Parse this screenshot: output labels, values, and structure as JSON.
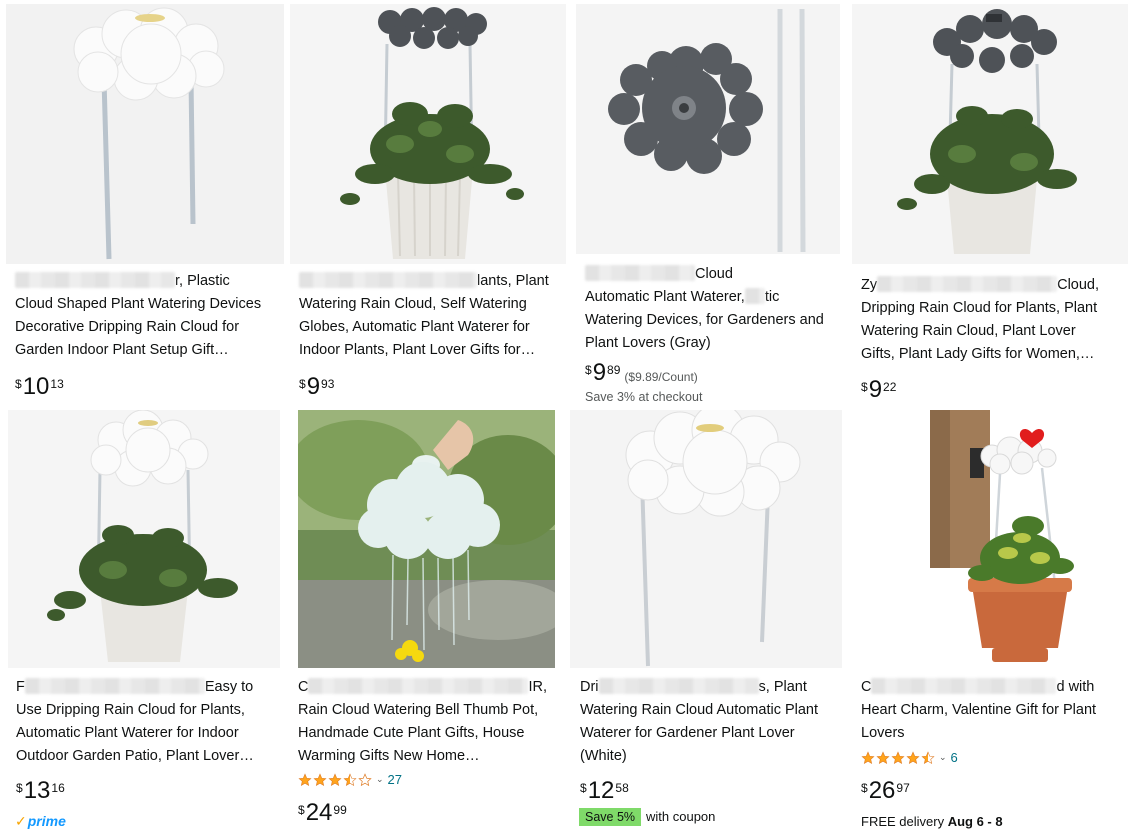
{
  "products": [
    {
      "title_visible": "r, Plastic Cloud Shaped Plant Watering Devices Decorative Dripping Rain Cloud for Garden Indoor Plant Setup Gift…",
      "line1": "r, Plastic",
      "line2": "Cloud Shaped Plant Watering Devices",
      "line3": "Decorative Dripping Rain Cloud for",
      "line4": "Garden Indoor Plant Setup Gift…",
      "price_symbol": "$",
      "price_whole": "10",
      "price_fraction": "13",
      "image_alt": "white-cloud-waterer"
    },
    {
      "line1a": "lants, Plant",
      "line2": "Watering Rain Cloud, Self Watering",
      "line3": "Globes, Automatic Plant Waterer for",
      "line4": "Indoor Plants, Plant Lover Gifts for…",
      "price_symbol": "$",
      "price_whole": "9",
      "price_fraction": "93",
      "image_alt": "gray-cloud-with-plant"
    },
    {
      "line1": "Cloud",
      "line2a": "Automatic Plant Waterer,",
      "line2b": "tic",
      "line3": "Watering Devices, for Gardeners and",
      "line4": "Plant Lovers (Gray)",
      "price_symbol": "$",
      "price_whole": "9",
      "price_fraction": "89",
      "unit_price": "($9.89/Count)",
      "save_text": "Save 3% at checkout",
      "image_alt": "gray-cloud-top-view"
    },
    {
      "line1a": "Zy",
      "line1b": "Cloud,",
      "line2": "Dripping Rain Cloud for Plants, Plant",
      "line3": "Watering Rain Cloud, Plant Lover",
      "line4": "Gifts, Plant Lady Gifts for Women,…",
      "price_symbol": "$",
      "price_whole": "9",
      "price_fraction": "22",
      "image_alt": "gray-cloud-with-plant-2"
    },
    {
      "line1a": "F",
      "line1b": "Easy to",
      "line2": "Use Dripping Rain Cloud for Plants,",
      "line3": "Automatic Plant Waterer for Indoor",
      "line4": "Outdoor Garden Patio, Plant Lover…",
      "price_symbol": "$",
      "price_whole": "13",
      "price_fraction": "16",
      "prime_label": "prime",
      "image_alt": "white-cloud-with-plant"
    },
    {
      "line1a": "C",
      "line1b": "IR,",
      "line2": "Rain Cloud Watering Bell Thumb Pot,",
      "line3": "Handmade Cute Plant Gifts, House",
      "line4": "Warming Gifts New Home…",
      "rating": 3.5,
      "review_count": "27",
      "price_symbol": "$",
      "price_whole": "24",
      "price_fraction": "99",
      "image_alt": "ceramic-cloud-watering-outdoor"
    },
    {
      "line1a": "Dri",
      "line1b": "s, Plant",
      "line2": "Watering Rain Cloud Automatic Plant",
      "line3": "Waterer for Gardener Plant Lover",
      "line4": "(White)",
      "price_symbol": "$",
      "price_whole": "12",
      "price_fraction": "58",
      "badge": "Save 5%",
      "coupon_text": "with coupon",
      "image_alt": "white-cloud-stakes"
    },
    {
      "line1a": "C",
      "line1b": "d with",
      "line2": "Heart Charm, Valentine Gift for Plant",
      "line3": "Lovers",
      "rating": 4.5,
      "review_count": "6",
      "price_symbol": "$",
      "price_whole": "26",
      "price_fraction": "97",
      "delivery_prefix": "FREE delivery",
      "delivery_date": "Aug 6 - 8",
      "image_alt": "cloud-with-heart-charm-terracotta"
    }
  ],
  "colors": {
    "link": "#007185",
    "star": "#ffa41c",
    "badge": "#7fda69",
    "prime": "#1399ff"
  }
}
